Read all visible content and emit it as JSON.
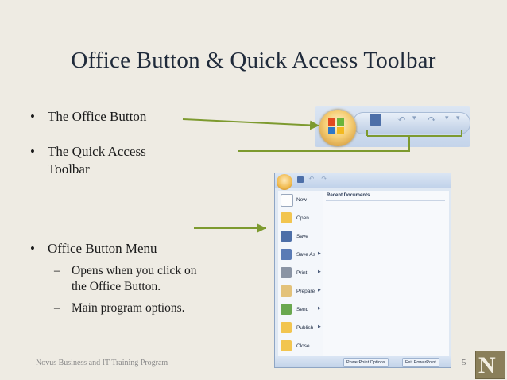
{
  "slide": {
    "title": "Office Button & Quick Access Toolbar",
    "bullets": [
      {
        "text": "The Office Button"
      },
      {
        "text_line1": "The Quick Access",
        "text_line2": "Toolbar"
      },
      {
        "text": "Office Button Menu"
      }
    ],
    "sub_bullets": [
      {
        "line1": "Opens when you click on",
        "line2": "the Office Button."
      },
      {
        "line1": "Main program options."
      }
    ],
    "bullet_char": "•",
    "dash_char": "–",
    "footer": "Novus Business and IT Training Program",
    "page_number": "5",
    "logo_letter": "N"
  },
  "office_menu": {
    "recent_header": "Recent Documents",
    "items": [
      {
        "label": "New",
        "icon": "new-document-icon",
        "submenu": false
      },
      {
        "label": "Open",
        "icon": "open-folder-icon",
        "submenu": false
      },
      {
        "label": "Save",
        "icon": "save-disk-icon",
        "submenu": false
      },
      {
        "label": "Save As",
        "icon": "save-as-icon",
        "submenu": true
      },
      {
        "label": "Print",
        "icon": "printer-icon",
        "submenu": true
      },
      {
        "label": "Prepare",
        "icon": "prepare-icon",
        "submenu": true
      },
      {
        "label": "Send",
        "icon": "send-icon",
        "submenu": true
      },
      {
        "label": "Publish",
        "icon": "publish-icon",
        "submenu": true
      },
      {
        "label": "Close",
        "icon": "close-folder-icon",
        "submenu": false
      }
    ],
    "footer_buttons": [
      "PowerPoint Options",
      "Exit PowerPoint"
    ]
  },
  "colors": {
    "background": "#eeebe3",
    "title": "#1f2a3a",
    "arrow": "#7d9a2f",
    "logo": "#8a7f5a"
  }
}
